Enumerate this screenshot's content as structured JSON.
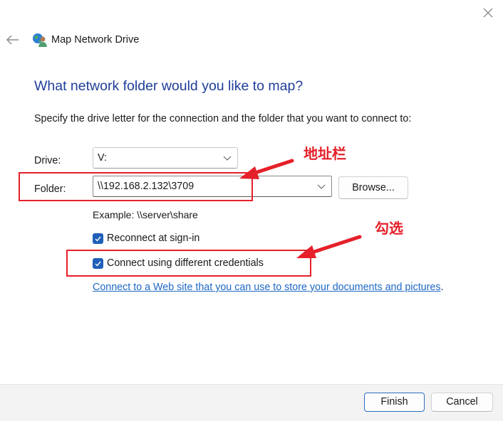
{
  "window": {
    "title": "Map Network Drive",
    "close_icon": "close-icon",
    "back_icon": "back-arrow-icon",
    "app_icon": "network-drive-icon"
  },
  "main": {
    "heading": "What network folder would you like to map?",
    "instruction": "Specify the drive letter for the connection and the folder that you want to connect to:",
    "drive": {
      "label": "Drive:",
      "value": "V:"
    },
    "folder": {
      "label": "Folder:",
      "value": "\\\\192.168.2.132\\3709",
      "browse_label": "Browse..."
    },
    "example": "Example: \\\\server\\share",
    "options": [
      {
        "label": "Reconnect at sign-in",
        "checked": true
      },
      {
        "label": "Connect using different credentials",
        "checked": true
      }
    ],
    "link": {
      "text": "Connect to a Web site that you can use to store your documents and pictures",
      "suffix": "."
    }
  },
  "footer": {
    "finish_label": "Finish",
    "cancel_label": "Cancel"
  },
  "annotations": {
    "address_bar_label": "地址栏",
    "check_label": "勾选",
    "color": "#e5202a"
  },
  "colors": {
    "heading": "#1f3e9a",
    "accent": "#1f5fb8",
    "link": "#1e68c4"
  }
}
